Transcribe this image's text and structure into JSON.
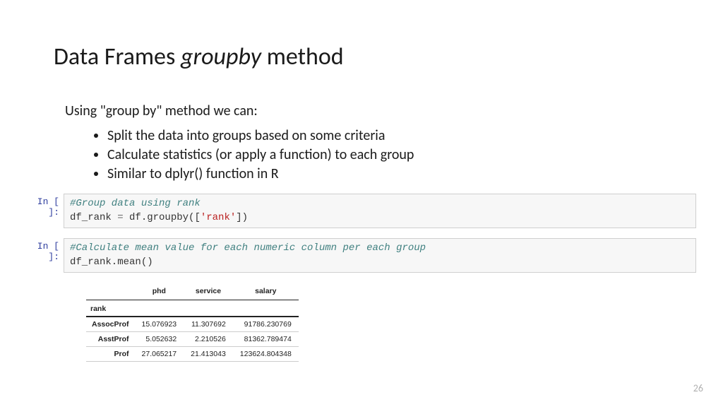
{
  "title": {
    "pre": "Data Frames ",
    "italic": "groupby",
    "post": " method"
  },
  "intro": "Using \"group by\" method we can:",
  "bullets": [
    "Split the data into groups based on some criteria",
    "Calculate statistics (or apply a function) to each group",
    "Similar to dplyr() function in R"
  ],
  "cells": [
    {
      "prompt": "In [ ]:",
      "code": {
        "comment": "#Group data using rank",
        "line2_pre": "df_rank ",
        "line2_eq": "=",
        "line2_mid": " df.groupby([",
        "line2_str": "'rank'",
        "line2_post": "])"
      }
    },
    {
      "prompt": "In [ ]:",
      "code": {
        "comment": "#Calculate mean value for each numeric column per each group",
        "line2": "df_rank.mean()"
      }
    }
  ],
  "table": {
    "columns": [
      "phd",
      "service",
      "salary"
    ],
    "index_name": "rank",
    "rows": [
      {
        "label": "AssocProf",
        "phd": "15.076923",
        "service": "11.307692",
        "salary": "91786.230769"
      },
      {
        "label": "AsstProf",
        "phd": "5.052632",
        "service": "2.210526",
        "salary": "81362.789474"
      },
      {
        "label": "Prof",
        "phd": "27.065217",
        "service": "21.413043",
        "salary": "123624.804348"
      }
    ]
  },
  "pageNumber": "26"
}
